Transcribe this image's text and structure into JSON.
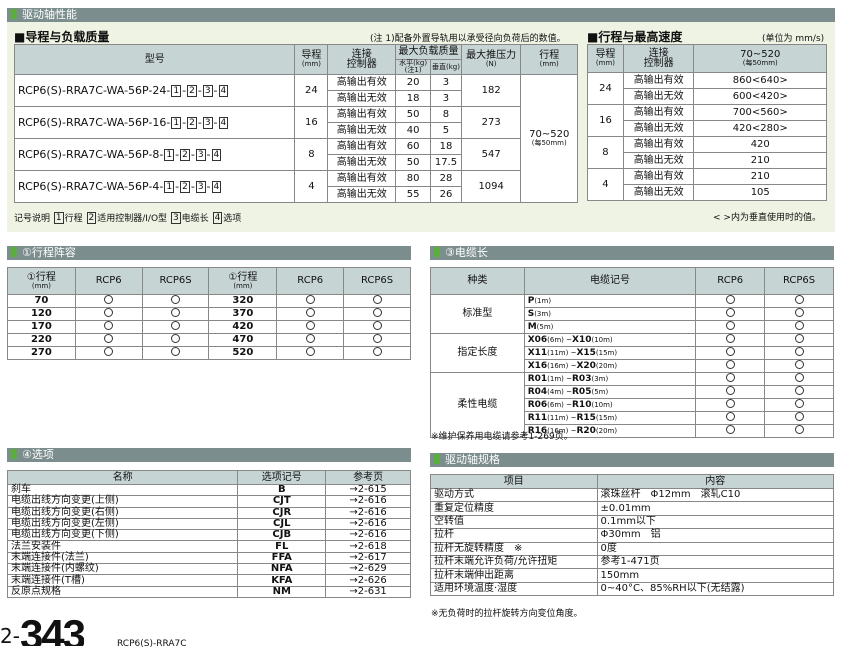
{
  "sec_drive": "驱动轴性能",
  "stroke_load_title": "■导程与负载质量",
  "note1": "(注 1)配备外置导轨用以承受径向负荷后的数值。",
  "speed_title": "■行程与最高速度",
  "speed_unit": "(单位为 mm/s)",
  "model_table": {
    "h_model": "型号",
    "h_lead": "导程",
    "h_lead_unit": "(mm)",
    "h_ctrl1": "连接",
    "h_ctrl2": "控制器",
    "h_load": "最大负载质量",
    "h_load_h": "水平(kg)",
    "h_load_h_note": "(注1)",
    "h_load_v": "垂直(kg)",
    "h_push": "最大推压力",
    "h_push_unit": "(N)",
    "h_stroke": "行程",
    "h_stroke_unit": "(mm)",
    "stroke_val": "70~520",
    "stroke_val2": "(每50mm)",
    "rows": [
      {
        "model": "RCP6(S)-RRA7C-WA-56P-24-",
        "lead": "24",
        "push": "182",
        "r": [
          {
            "ctrl": "高输出有效",
            "h": "20",
            "v": "3"
          },
          {
            "ctrl": "高输出无效",
            "h": "18",
            "v": "3"
          }
        ]
      },
      {
        "model": "RCP6(S)-RRA7C-WA-56P-16-",
        "lead": "16",
        "push": "273",
        "r": [
          {
            "ctrl": "高输出有效",
            "h": "50",
            "v": "8"
          },
          {
            "ctrl": "高输出无效",
            "h": "40",
            "v": "5"
          }
        ]
      },
      {
        "model": "RCP6(S)-RRA7C-WA-56P-8-",
        "lead": "8",
        "push": "547",
        "r": [
          {
            "ctrl": "高输出有效",
            "h": "60",
            "v": "18"
          },
          {
            "ctrl": "高输出无效",
            "h": "50",
            "v": "17.5"
          }
        ]
      },
      {
        "model": "RCP6(S)-RRA7C-WA-56P-4-",
        "lead": "4",
        "push": "1094",
        "r": [
          {
            "ctrl": "高输出有效",
            "h": "80",
            "v": "28"
          },
          {
            "ctrl": "高输出无效",
            "h": "55",
            "v": "26"
          }
        ]
      }
    ],
    "suffix": [
      "1",
      "2",
      "3",
      "4"
    ]
  },
  "speed_table": {
    "h_lead": "导程",
    "h_lead_unit": "(mm)",
    "h_ctrl1": "连接",
    "h_ctrl2": "控制器",
    "h_range": "70~520",
    "h_range_unit": "(每50mm)",
    "rows": [
      {
        "lead": "24",
        "r": [
          {
            "ctrl": "高输出有效",
            "v": "860<640>"
          },
          {
            "ctrl": "高输出无效",
            "v": "600<420>"
          }
        ]
      },
      {
        "lead": "16",
        "r": [
          {
            "ctrl": "高输出有效",
            "v": "700<560>"
          },
          {
            "ctrl": "高输出无效",
            "v": "420<280>"
          }
        ]
      },
      {
        "lead": "8",
        "r": [
          {
            "ctrl": "高输出有效",
            "v": "420"
          },
          {
            "ctrl": "高输出无效",
            "v": "210"
          }
        ]
      },
      {
        "lead": "4",
        "r": [
          {
            "ctrl": "高输出有效",
            "v": "210"
          },
          {
            "ctrl": "高输出无效",
            "v": "105"
          }
        ]
      }
    ]
  },
  "legend": {
    "prefix": "记号说明",
    "items": [
      {
        "n": "1",
        "t": "行程"
      },
      {
        "n": "2",
        "t": "适用控制器/I/O型"
      },
      {
        "n": "3",
        "t": "电缆长"
      },
      {
        "n": "4",
        "t": "选项"
      }
    ]
  },
  "speed_note": "< >内为垂直使用时的值。",
  "sec_stroke": "①行程阵容",
  "stroke_list": {
    "h_stroke": "①行程",
    "h_unit": "(mm)",
    "h_rcp6": "RCP6",
    "h_rcp6s": "RCP6S",
    "left": [
      "70",
      "120",
      "170",
      "220",
      "270"
    ],
    "right": [
      "320",
      "370",
      "420",
      "470",
      "520"
    ]
  },
  "sec_cable": "③电缆长",
  "cable": {
    "h_type": "种类",
    "h_code": "电缆记号",
    "h_rcp6": "RCP6",
    "h_rcp6s": "RCP6S",
    "groups": [
      {
        "type": "标准型",
        "items": [
          {
            "c": "P",
            "l": "(1m)"
          },
          {
            "c": "S",
            "l": "(3m)"
          },
          {
            "c": "M",
            "l": "(5m)"
          }
        ]
      },
      {
        "type": "指定长度",
        "items": [
          {
            "c": "X06",
            "l": "(6m) ~",
            "c2": "X10",
            "l2": "(10m)"
          },
          {
            "c": "X11",
            "l": "(11m) ~",
            "c2": "X15",
            "l2": "(15m)"
          },
          {
            "c": "X16",
            "l": "(16m) ~",
            "c2": "X20",
            "l2": "(20m)"
          }
        ]
      },
      {
        "type": "柔性电缆",
        "items": [
          {
            "c": "R01",
            "l": "(1m) ~",
            "c2": "R03",
            "l2": "(3m)"
          },
          {
            "c": "R04",
            "l": "(4m) ~",
            "c2": "R05",
            "l2": "(5m)"
          },
          {
            "c": "R06",
            "l": "(6m) ~",
            "c2": "R10",
            "l2": "(10m)"
          },
          {
            "c": "R11",
            "l": "(11m) ~",
            "c2": "R15",
            "l2": "(15m)"
          },
          {
            "c": "R16",
            "l": "(16m) ~",
            "c2": "R20",
            "l2": "(20m)"
          }
        ]
      }
    ],
    "note": "※维护保养用电缆请参考1-269页。"
  },
  "sec_option": "④选项",
  "option": {
    "h_name": "名称",
    "h_code": "选项记号",
    "h_page": "参考页",
    "rows": [
      {
        "n": "刹车",
        "c": "B",
        "p": "→2-615"
      },
      {
        "n": "电缆出线方向变更(上侧)",
        "c": "CJT",
        "p": "→2-616"
      },
      {
        "n": "电缆出线方向变更(右侧)",
        "c": "CJR",
        "p": "→2-616"
      },
      {
        "n": "电缆出线方向变更(左侧)",
        "c": "CJL",
        "p": "→2-616"
      },
      {
        "n": "电缆出线方向变更(下侧)",
        "c": "CJB",
        "p": "→2-616"
      },
      {
        "n": "法兰安装件",
        "c": "FL",
        "p": "→2-618"
      },
      {
        "n": "末端连接件(法兰)",
        "c": "FFA",
        "p": "→2-617"
      },
      {
        "n": "末端连接件(内螺纹)",
        "c": "NFA",
        "p": "→2-629"
      },
      {
        "n": "末端连接件(T槽)",
        "c": "KFA",
        "p": "→2-626"
      },
      {
        "n": "反原点规格",
        "c": "NM",
        "p": "→2-631"
      }
    ]
  },
  "sec_spec": "驱动轴规格",
  "spec": {
    "h_item": "项目",
    "h_content": "内容",
    "rows": [
      {
        "i": "驱动方式",
        "c": "滚珠丝杆　Φ12mm　滚轧C10"
      },
      {
        "i": "重复定位精度",
        "c": "±0.01mm"
      },
      {
        "i": "空转值",
        "c": "0.1mm以下"
      },
      {
        "i": "拉杆",
        "c": "Φ30mm　铝"
      },
      {
        "i": "拉杆无旋转精度　※",
        "c": "0度"
      },
      {
        "i": "拉杆末端允许负荷/允许扭矩",
        "c": "参考1-471页"
      },
      {
        "i": "拉杆末端伸出距离",
        "c": "150mm"
      },
      {
        "i": "适用环境温度·湿度",
        "c": "0~40°C、85%RH以下(无结露)"
      }
    ],
    "note": "※无负荷时的拉杆旋转方向变位角度。"
  },
  "page_prefix": "2-",
  "page_num": "343",
  "footer_model": "RCP6(S)-RRA7C"
}
